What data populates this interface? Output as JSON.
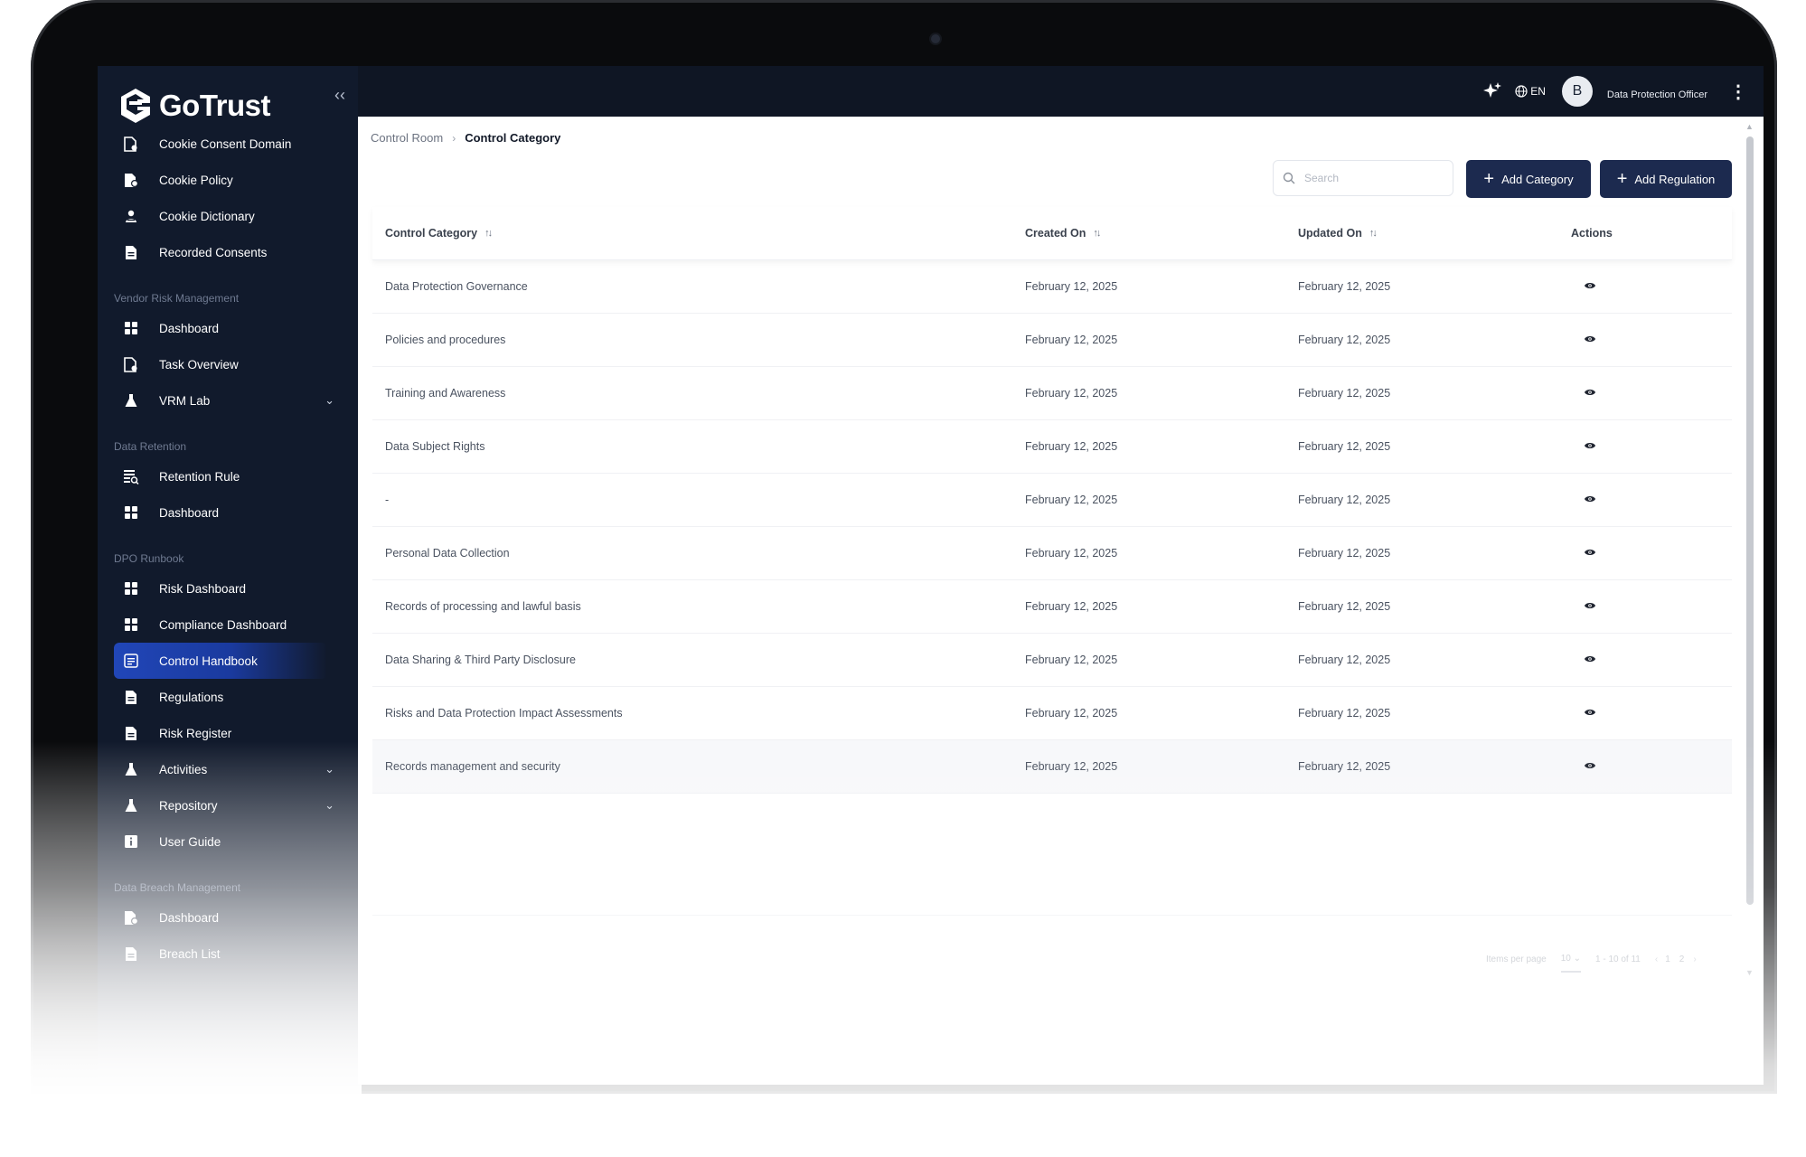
{
  "app": {
    "name": "GoTrust"
  },
  "sidebar": {
    "items": [
      {
        "label": "Cookie Consent Domain",
        "icon": "file-gear-icon",
        "type": "item"
      },
      {
        "label": "Cookie Policy",
        "icon": "file-icon",
        "type": "item"
      },
      {
        "label": "Cookie Dictionary",
        "icon": "user-file-icon",
        "type": "item"
      },
      {
        "label": "Recorded Consents",
        "icon": "document-icon",
        "type": "item"
      },
      {
        "label": "Vendor Risk Management",
        "type": "section"
      },
      {
        "label": "Dashboard",
        "icon": "grid-icon",
        "type": "item"
      },
      {
        "label": "Task Overview",
        "icon": "file-gear-icon",
        "type": "item"
      },
      {
        "label": "VRM Lab",
        "icon": "flask-icon",
        "type": "item",
        "expandable": true
      },
      {
        "label": "Data Retention",
        "type": "section"
      },
      {
        "label": "Retention Rule",
        "icon": "list-search-icon",
        "type": "item"
      },
      {
        "label": "Dashboard",
        "icon": "grid-icon",
        "type": "item"
      },
      {
        "label": "DPO Runbook",
        "type": "section"
      },
      {
        "label": "Risk Dashboard",
        "icon": "grid-icon",
        "type": "item"
      },
      {
        "label": "Compliance Dashboard",
        "icon": "grid-icon",
        "type": "item"
      },
      {
        "label": "Control Handbook",
        "icon": "handbook-icon",
        "type": "item",
        "active": true
      },
      {
        "label": "Regulations",
        "icon": "document-icon",
        "type": "item"
      },
      {
        "label": "Risk Register",
        "icon": "document-icon",
        "type": "item"
      },
      {
        "label": "Activities",
        "icon": "flask-icon",
        "type": "item",
        "expandable": true
      },
      {
        "label": "Repository",
        "icon": "flask-icon",
        "type": "item",
        "expandable": true
      },
      {
        "label": "User Guide",
        "icon": "guide-icon",
        "type": "item"
      },
      {
        "label": "Data Breach Management",
        "type": "section"
      },
      {
        "label": "Dashboard",
        "icon": "file-icon",
        "type": "item"
      },
      {
        "label": "Breach List",
        "icon": "document-icon",
        "type": "item"
      }
    ]
  },
  "topbar": {
    "language": "EN",
    "avatar_initial": "B",
    "role": "Data Protection Officer"
  },
  "breadcrumb": {
    "parent": "Control Room",
    "current": "Control Category"
  },
  "search": {
    "placeholder": "Search"
  },
  "buttons": {
    "add_category": "Add Category",
    "add_regulation": "Add Regulation"
  },
  "table": {
    "headers": {
      "category": "Control Category",
      "created": "Created On",
      "updated": "Updated On",
      "actions": "Actions"
    },
    "rows": [
      {
        "category": "Data Protection Governance",
        "created": "February 12, 2025",
        "updated": "February 12, 2025"
      },
      {
        "category": "Policies and procedures",
        "created": "February 12, 2025",
        "updated": "February 12, 2025"
      },
      {
        "category": "Training and Awareness",
        "created": "February 12, 2025",
        "updated": "February 12, 2025"
      },
      {
        "category": "Data Subject Rights",
        "created": "February 12, 2025",
        "updated": "February 12, 2025"
      },
      {
        "category": "-",
        "created": "February 12, 2025",
        "updated": "February 12, 2025"
      },
      {
        "category": "Personal Data Collection",
        "created": "February 12, 2025",
        "updated": "February 12, 2025"
      },
      {
        "category": "Records of processing and lawful basis",
        "created": "February 12, 2025",
        "updated": "February 12, 2025"
      },
      {
        "category": "Data Sharing & Third Party Disclosure",
        "created": "February 12, 2025",
        "updated": "February 12, 2025"
      },
      {
        "category": "Risks and Data Protection Impact Assessments",
        "created": "February 12, 2025",
        "updated": "February 12, 2025"
      },
      {
        "category": "Records management and security",
        "created": "February 12, 2025",
        "updated": "February 12, 2025"
      }
    ]
  },
  "pagination": {
    "items_per_page_label": "Items per page",
    "per_page": "10",
    "range": "1 - 10 of 11",
    "pages": [
      "1",
      "2"
    ]
  },
  "colors": {
    "sidebar_bg": "#111a2c",
    "active_item": "#2146b8",
    "primary_button": "#1c2a4f"
  }
}
